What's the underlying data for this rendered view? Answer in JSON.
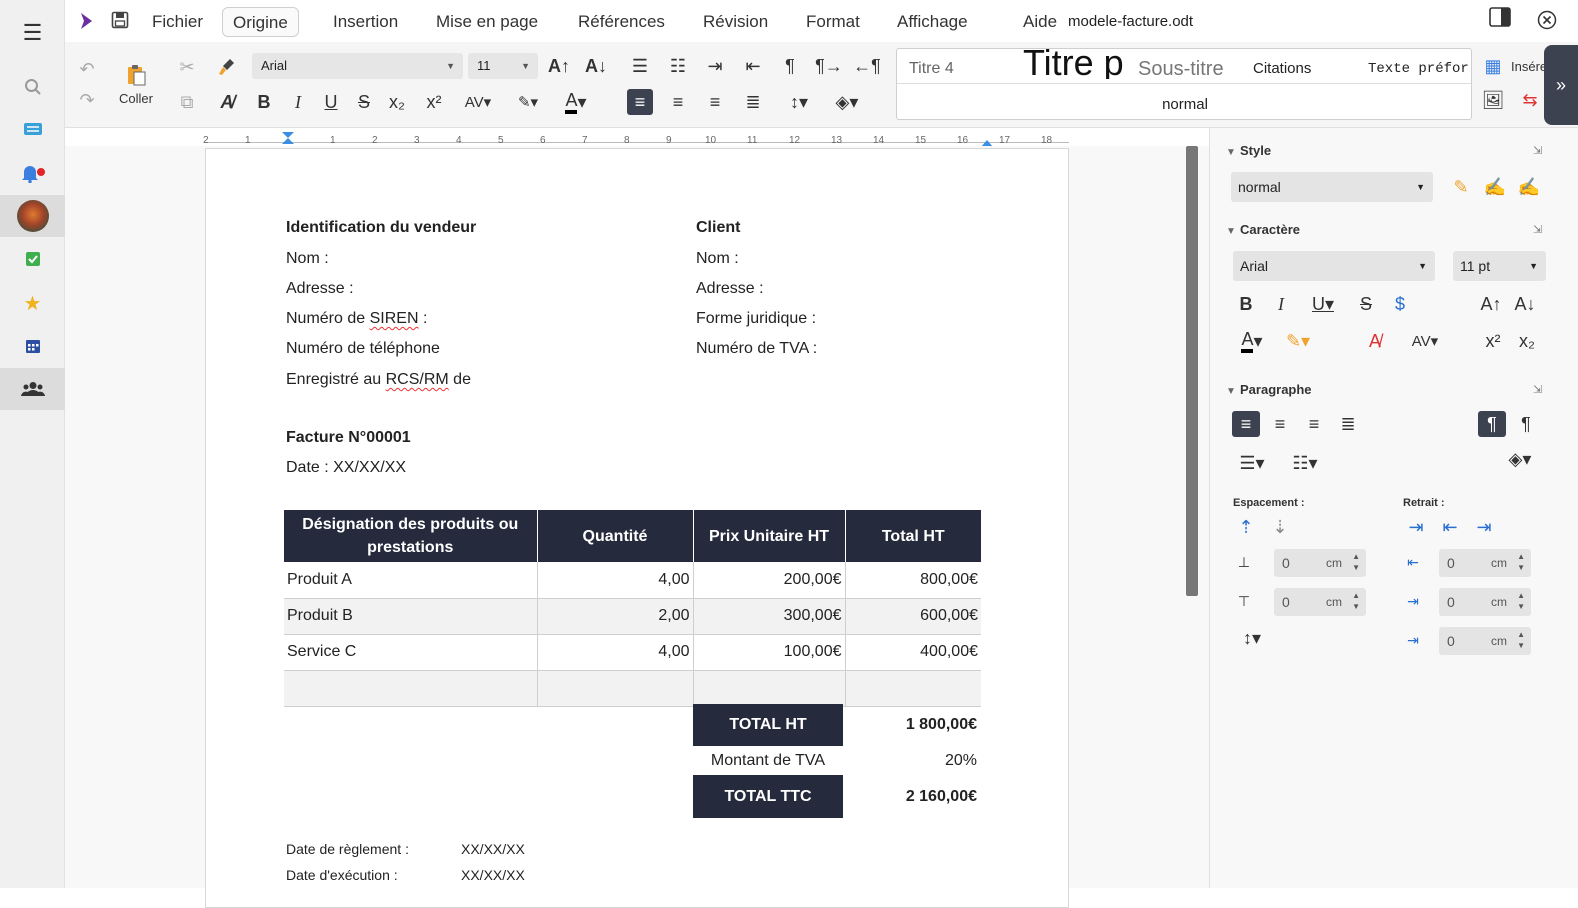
{
  "menubar": {
    "items": [
      "Fichier",
      "Origine",
      "Insertion",
      "Mise en page",
      "Références",
      "Révision",
      "Format",
      "Affichage",
      "Aide"
    ],
    "filename": "modele-facture.odt"
  },
  "toolbar": {
    "paste_label": "Coller",
    "font_name": "Arial",
    "font_size": "11",
    "styles": [
      "Titre 4",
      "Titre p",
      "Sous-titre",
      "Citations",
      "Texte préfor"
    ],
    "current_style": "normal",
    "insert_label": "Insére"
  },
  "ruler": {
    "ticks": [
      "2",
      "1",
      "1",
      "2",
      "3",
      "4",
      "5",
      "6",
      "7",
      "8",
      "9",
      "10",
      "11",
      "12",
      "13",
      "14",
      "15",
      "16",
      "17",
      "18"
    ]
  },
  "document": {
    "vendor_title": "Identification du vendeur",
    "vendor_fields": [
      "Nom :",
      "Adresse :",
      "Numéro de",
      "Numéro de téléphone",
      "Enregistré au"
    ],
    "siren": "SIREN",
    "siren_suffix": " :",
    "rcs": "RCS/RM",
    "rcs_suffix": " de",
    "client_title": "Client",
    "client_fields": [
      "Nom :",
      "Adresse :",
      "Forme juridique :",
      "Numéro de TVA :"
    ],
    "invoice_no": "Facture N°00001",
    "date": "Date : XX/XX/XX",
    "table": {
      "headers": [
        "Désignation des produits ou prestations",
        "Quantité",
        "Prix Unitaire HT",
        "Total HT"
      ],
      "rows": [
        [
          "Produit A",
          "4,00",
          "200,00€",
          "800,00€"
        ],
        [
          "Produit B",
          "2,00",
          "300,00€",
          "600,00€"
        ],
        [
          "Service C",
          "4,00",
          "100,00€",
          "400,00€"
        ]
      ]
    },
    "total_ht_label": "TOTAL HT",
    "total_ht_value": "1 800,00€",
    "tva_label": "Montant de TVA",
    "tva_value": "20%",
    "total_ttc_label": "TOTAL TTC",
    "total_ttc_value": "2 160,00€",
    "payment_date_label": "Date de règlement :",
    "payment_date_value": "XX/XX/XX",
    "execution_date_label": "Date d'exécution :",
    "execution_date_value": "XX/XX/XX"
  },
  "sidebar": {
    "style_title": "Style",
    "style_value": "normal",
    "char_title": "Caractère",
    "font_value": "Arial",
    "size_value": "11 pt",
    "para_title": "Paragraphe",
    "spacing_label": "Espacement :",
    "indent_label": "Retrait :",
    "spin_value": "0",
    "unit": "cm"
  },
  "colors": {
    "accent_dark": "#252a3c",
    "rail_icon": "#4a7fd6",
    "brand": "#6b2fa0"
  }
}
